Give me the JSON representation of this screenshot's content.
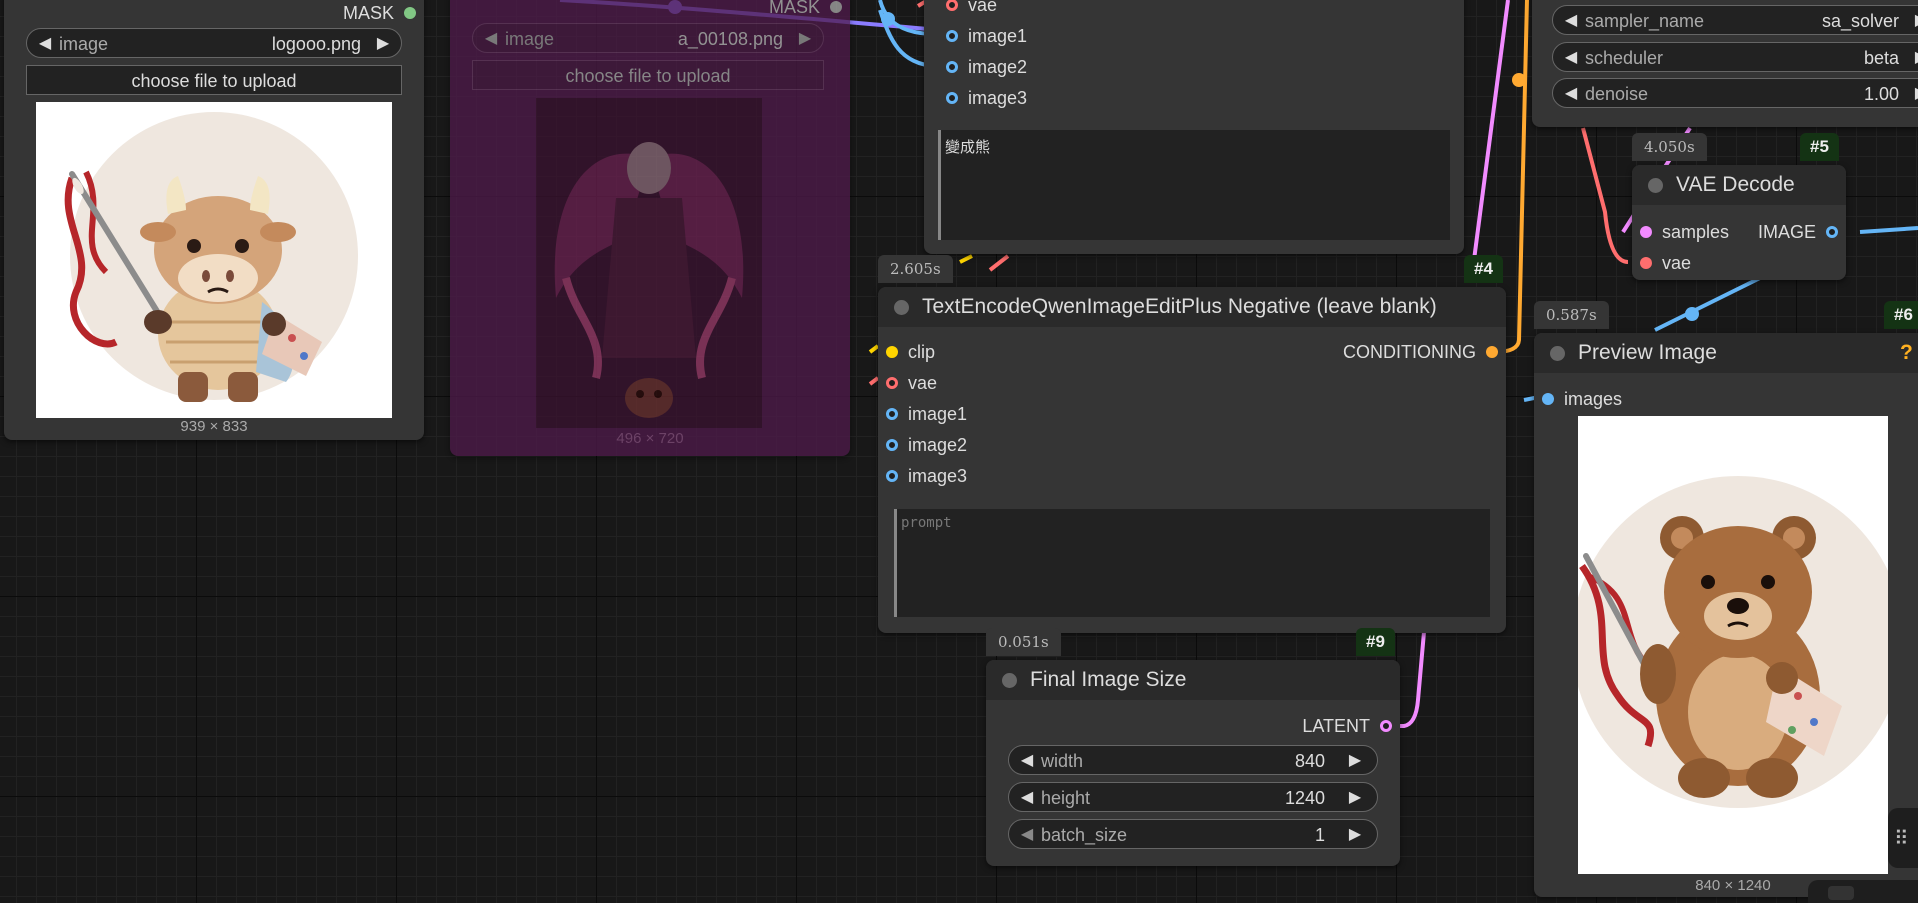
{
  "nodes": {
    "load_image_1": {
      "mask_label": "MASK",
      "image_widget": {
        "label": "image",
        "value": "logooo.png"
      },
      "upload_label": "choose file to upload",
      "dimensions": "939 × 833"
    },
    "load_image_2": {
      "mask_label": "MASK",
      "image_widget": {
        "label": "image",
        "value": "a_00108.png"
      },
      "upload_label": "choose file to upload",
      "dimensions": "496 × 720"
    },
    "text_encode_positive": {
      "inputs": [
        "vae",
        "image1",
        "image2",
        "image3"
      ],
      "prompt_text": "變成熊"
    },
    "text_encode_negative": {
      "exec_time": "2.605s",
      "id": "#4",
      "title": "TextEncodeQwenImageEditPlus Negative (leave blank)",
      "inputs": [
        "clip",
        "vae",
        "image1",
        "image2",
        "image3"
      ],
      "output": "CONDITIONING",
      "prompt_placeholder": "prompt"
    },
    "ksampler": {
      "widgets": [
        {
          "label": "sampler_name",
          "value": "sa_solver"
        },
        {
          "label": "scheduler",
          "value": "beta"
        },
        {
          "label": "denoise",
          "value": "1.00"
        }
      ]
    },
    "vae_decode": {
      "exec_time": "4.050s",
      "id": "#5",
      "title": "VAE Decode",
      "inputs": [
        "samples",
        "vae"
      ],
      "output": "IMAGE"
    },
    "preview_image": {
      "exec_time": "0.587s",
      "id": "#6",
      "title": "Preview Image",
      "help": "?",
      "input": "images",
      "dimensions": "840 × 1240"
    },
    "final_image_size": {
      "exec_time": "0.051s",
      "id": "#9",
      "title": "Final Image Size",
      "output": "LATENT",
      "widgets": [
        {
          "label": "width",
          "value": "840"
        },
        {
          "label": "height",
          "value": "1240"
        },
        {
          "label": "batch_size",
          "value": "1"
        }
      ]
    }
  },
  "icons": {
    "arrow_left": "◀",
    "arrow_right": "▶",
    "drag_handle": "⠿"
  },
  "colors": {
    "canvas": "#181818",
    "node_body": "#353535",
    "node_title": "#2a2a2a",
    "bypassed": "#4f1a4b",
    "clip": "#ffd500",
    "vae": "#ff6e6e",
    "image": "#64b5f6",
    "latent": "#f28bff",
    "conditioning": "#ffa931",
    "mask": "#81c784",
    "id_badge": "#143314"
  }
}
